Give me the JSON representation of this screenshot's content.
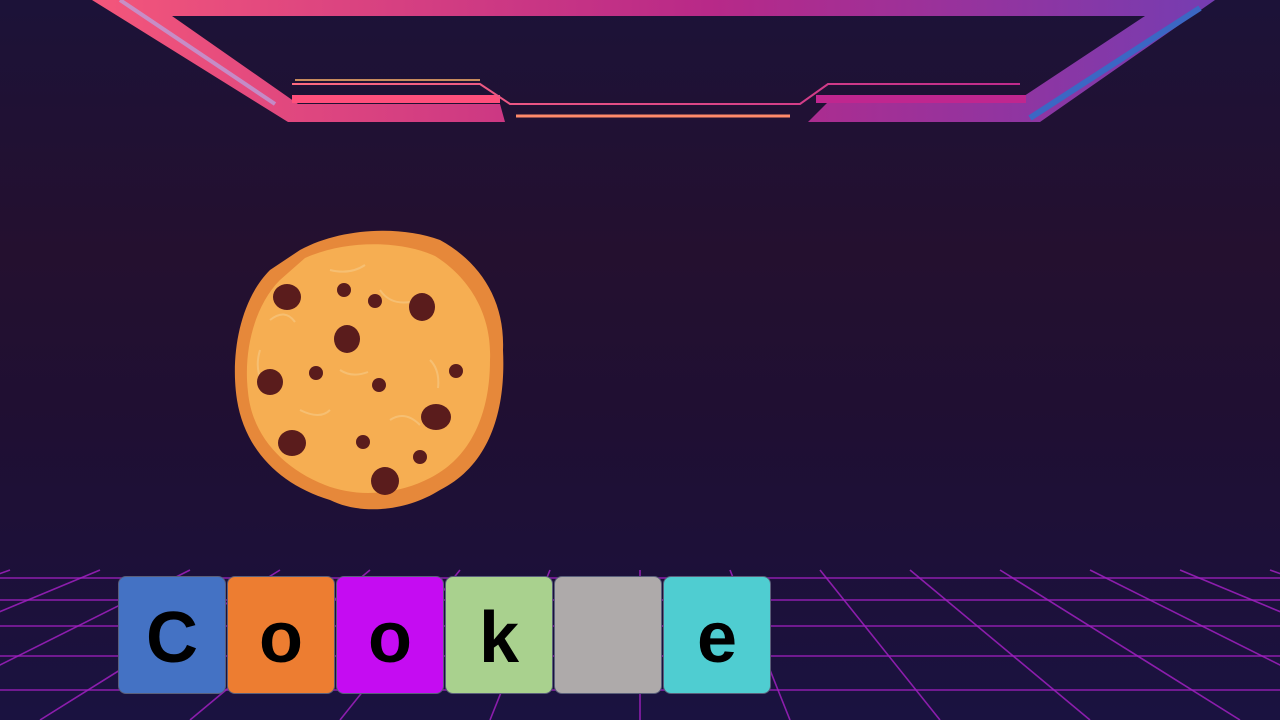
{
  "game": {
    "picture": "chocolate-chip-cookie",
    "tiles": [
      {
        "letter": "C",
        "color": "#4472c4"
      },
      {
        "letter": "o",
        "color": "#ed7d31"
      },
      {
        "letter": "o",
        "color": "#c50cf2"
      },
      {
        "letter": "k",
        "color": "#a9d18e"
      },
      {
        "letter": "",
        "color": "#aeaaaa"
      },
      {
        "letter": "e",
        "color": "#4fcdd1"
      }
    ]
  },
  "theme": {
    "frame_pink": "#ff4f7b",
    "frame_magenta": "#c0268f",
    "frame_blue": "#2f5fb0",
    "grid_color": "#a020c0",
    "cookie_color": "#f6ae52",
    "cookie_edge": "#e6883a",
    "chip_color": "#5a1c1c"
  }
}
